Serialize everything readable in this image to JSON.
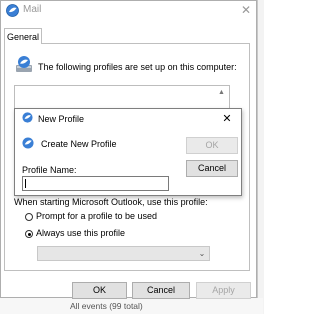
{
  "mail_dialog": {
    "title": "Mail",
    "close_glyph": "✕",
    "icon": "mail-app-icon",
    "tab_label": "General",
    "intro_text": "The following profiles are set up on this computer:",
    "startup_label": "When starting Microsoft Outlook, use this profile:",
    "radio_prompt_label": "Prompt for a profile to be used",
    "radio_always_label": "Always use this profile",
    "selected_startup_option": "always",
    "profile_select_value": "",
    "buttons": {
      "ok": "OK",
      "cancel": "Cancel",
      "apply": "Apply"
    }
  },
  "new_profile_dialog": {
    "title": "New Profile",
    "close_glyph": "✕",
    "create_label": "Create New Profile",
    "ok_label": "OK",
    "cancel_label": "Cancel",
    "profile_name_label": "Profile Name:",
    "profile_name_value": ""
  },
  "background": {
    "status_text": "All events (99 total)"
  },
  "colors": {
    "accent_blue": "#3a7fd5",
    "button_face": "#e1e1e1",
    "disabled_text": "#a5a5a5",
    "border_gray": "#adadad"
  }
}
